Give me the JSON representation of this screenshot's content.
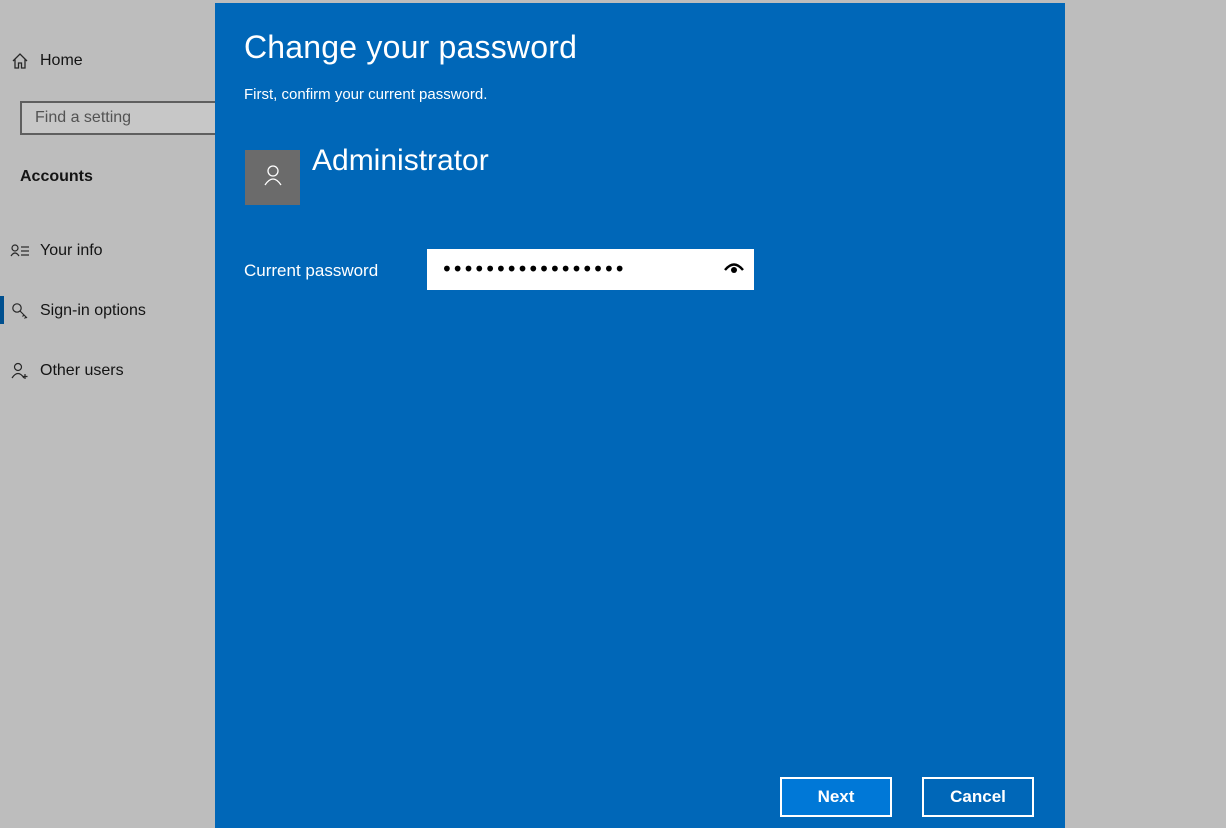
{
  "sidebar": {
    "home_label": "Home",
    "search_placeholder": "Find a setting",
    "section_title": "Accounts",
    "items": [
      {
        "label": "Your info",
        "icon": "contact-info-icon"
      },
      {
        "label": "Sign-in options",
        "icon": "key-icon",
        "active": true
      },
      {
        "label": "Other users",
        "icon": "add-person-icon"
      }
    ]
  },
  "dialog": {
    "title": "Change your password",
    "subtitle": "First, confirm your current password.",
    "username": "Administrator",
    "avatar_icon": "user-icon",
    "password_label": "Current password",
    "password_value_masked": "•••••••••••••••••",
    "reveal_icon": "eye-icon",
    "next_label": "Next",
    "cancel_label": "Cancel"
  },
  "colors": {
    "dialog_bg": "#0067b8",
    "accent": "#0078d7",
    "sidebar_bg": "#f2f2f2"
  }
}
